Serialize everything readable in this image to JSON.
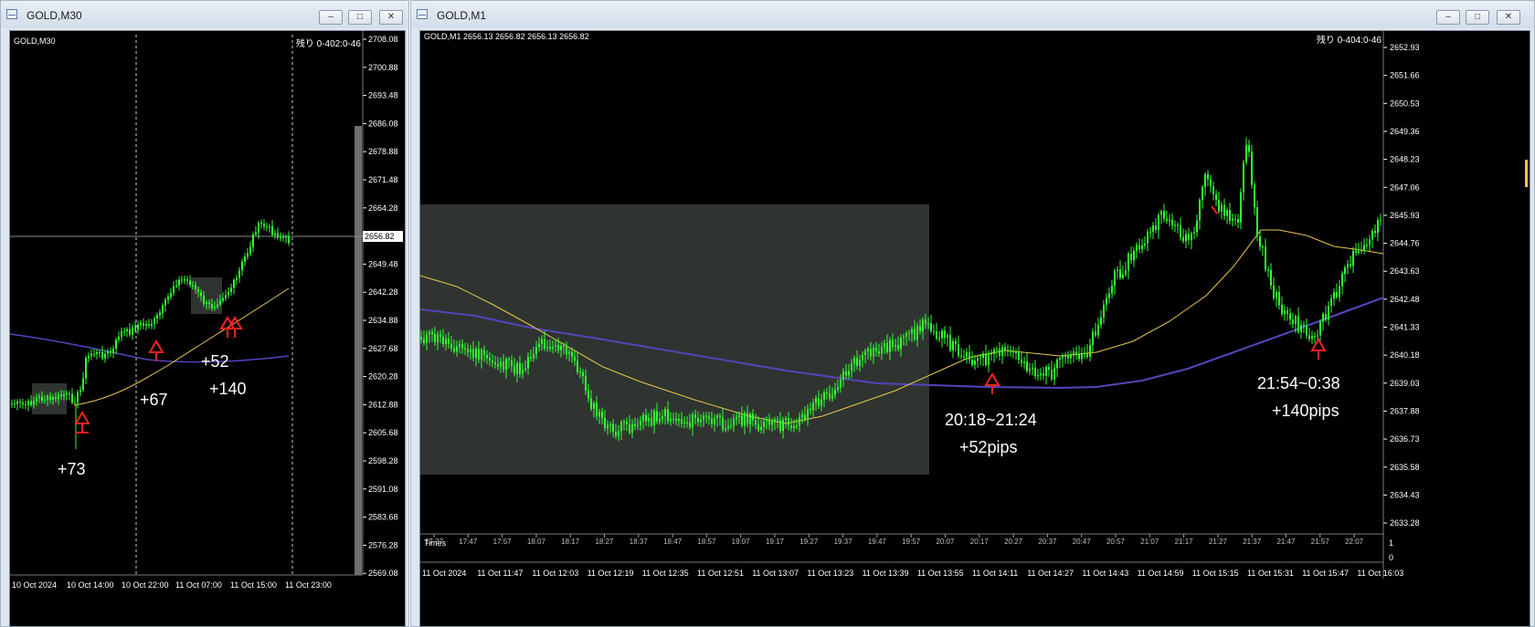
{
  "left_window": {
    "title": "GOLD,M30",
    "symbol_label": "GOLD,M30",
    "countdown": "残り 0-402:0-46",
    "current_price": "2656.82",
    "price_ticks": [
      "2708.08",
      "2700.88",
      "2693.48",
      "2686.08",
      "2678.88",
      "2671.48",
      "2664.28",
      "2656.82",
      "2649.48",
      "2642.28",
      "2634.88",
      "2627.68",
      "2620.28",
      "2612.88",
      "2605.68",
      "2598.28",
      "2591.08",
      "2583.68",
      "2576.28",
      "2569.08"
    ],
    "time_ticks": [
      "10 Oct 2024",
      "10 Oct 14:00",
      "10 Oct 22:00",
      "11 Oct 07:00",
      "11 Oct 15:00",
      "11 Oct 23:00"
    ],
    "annotations": [
      "+73",
      "+67",
      "+52",
      "+140"
    ]
  },
  "right_window": {
    "title": "GOLD,M1",
    "symbol_label": "GOLD,M1  2656.13 2656.82 2656.13 2656.82",
    "countdown": "残り 0-404:0-46",
    "price_ticks": [
      "2652.93",
      "2651.66",
      "2650.53",
      "2649.36",
      "2648.23",
      "2647.06",
      "2645.93",
      "2644.76",
      "2643.63",
      "2642.48",
      "2641.33",
      "2640.18",
      "2639.03",
      "2637.88",
      "2636.73",
      "2635.58",
      "2634.43",
      "2633.28"
    ],
    "times_panel_label": "Times",
    "times_panel_scale": [
      "1",
      "0"
    ],
    "times_axis": [
      "17:37",
      "17:47",
      "17:57",
      "18:07",
      "18:17",
      "18:27",
      "18:37",
      "18:47",
      "18:57",
      "19:07",
      "19:17",
      "19:27",
      "19:37",
      "19:47",
      "19:57",
      "20:07",
      "20:17",
      "20:27",
      "20:37",
      "20:47",
      "20:57",
      "21:07",
      "21:17",
      "21:27",
      "21:37",
      "21:47",
      "21:57",
      "22:07"
    ],
    "date_axis": [
      "11 Oct 2024",
      "11 Oct 11:47",
      "11 Oct 12:03",
      "11 Oct 12:19",
      "11 Oct 12:35",
      "11 Oct 12:51",
      "11 Oct 13:07",
      "11 Oct 13:23",
      "11 Oct 13:39",
      "11 Oct 13:55",
      "11 Oct 14:11",
      "11 Oct 14:27",
      "11 Oct 14:43",
      "11 Oct 14:59",
      "11 Oct 15:15",
      "11 Oct 15:31",
      "11 Oct 15:47",
      "11 Oct 16:03"
    ],
    "annotation1": {
      "time": "20:18~21:24",
      "pips": "+52pips"
    },
    "annotation2": {
      "time": "21:54~0:38",
      "pips": "+140pips"
    }
  },
  "window_controls": {
    "minimize": "–",
    "maximize": "□",
    "close": "✕"
  },
  "colors": {
    "candle": "#33ff33",
    "ma_fast": "#e6c94a",
    "ma_slow": "#5544bb",
    "arrow": "#ff2020",
    "box": "#2f3431",
    "axis_text": "#ffffff"
  }
}
